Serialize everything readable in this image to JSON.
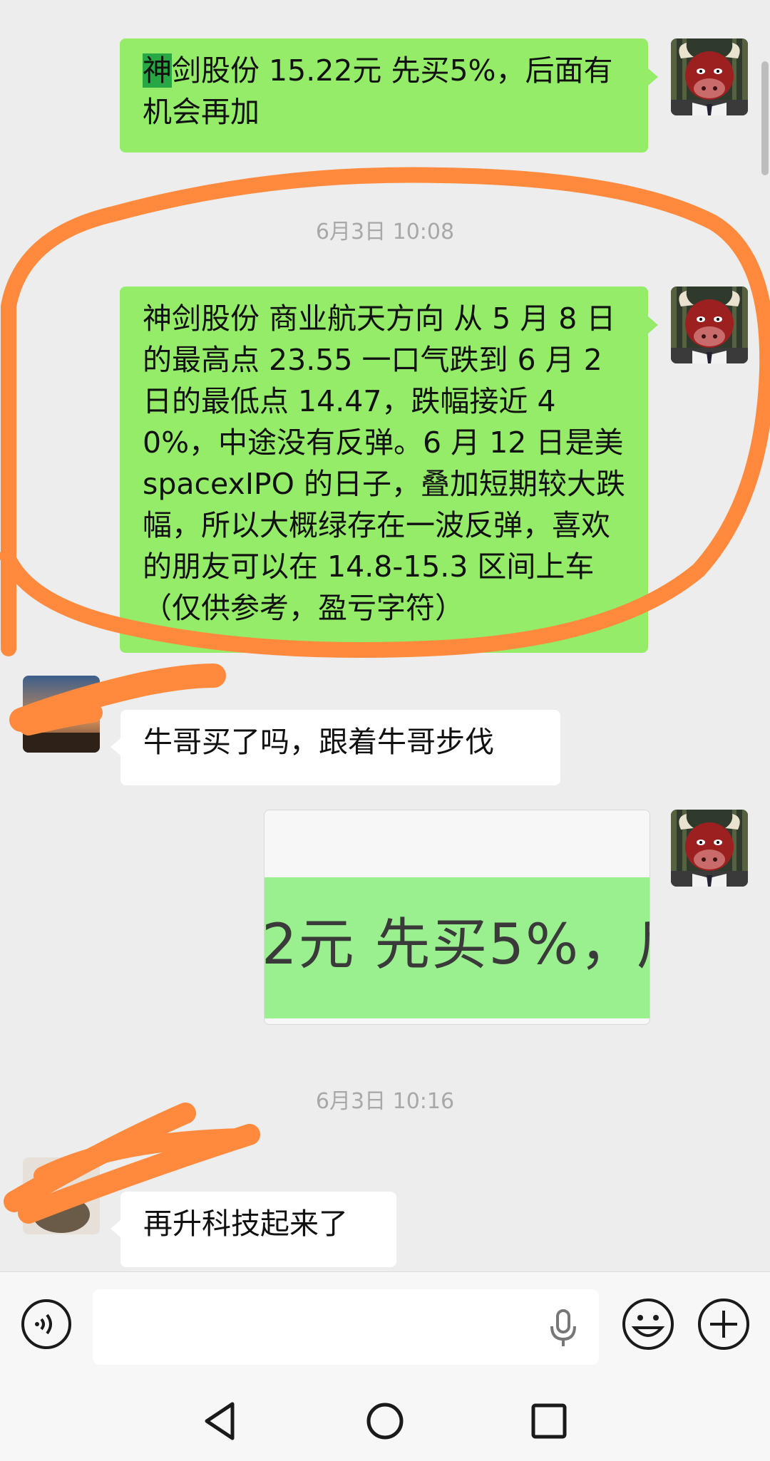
{
  "messages": [
    {
      "side": "right",
      "text_highlight": "神",
      "text_rest": "剑股份  15.22元 先买5%，后面有机会再加"
    },
    {
      "side": "right",
      "text": "神剑股份  商业航天方向  从 5 月 8 日的最高点 23.55 一口气跌到 6 月 2 日的最低点 14.47，跌幅接近 40%，中途没有反弹。6 月 12 日是美spacexIPO 的日子，叠加短期较大跌幅，所以大概绿存在一波反弹，喜欢的朋友可以在 14.8-15.3 区间上车（仅供参考，盈亏字符）"
    },
    {
      "side": "left",
      "text": "牛哥买了吗，跟着牛哥步伐"
    },
    {
      "side": "right",
      "image_text": "2元 先买5%，后"
    },
    {
      "side": "left",
      "text": "再升科技起来了"
    }
  ],
  "timestamps": [
    "6月3日 10:08",
    "6月3日 10:16"
  ],
  "icons": {
    "voice": "voice-icon",
    "mic": "mic-icon",
    "emoji": "emoji-icon",
    "plus": "plus-icon",
    "back": "nav-back-icon",
    "home": "nav-home-icon",
    "recents": "nav-recents-icon"
  },
  "colors": {
    "my_bubble": "#95ec69",
    "their_bubble": "#ffffff",
    "annotation": "#ff8a3d",
    "background": "#ededed"
  }
}
